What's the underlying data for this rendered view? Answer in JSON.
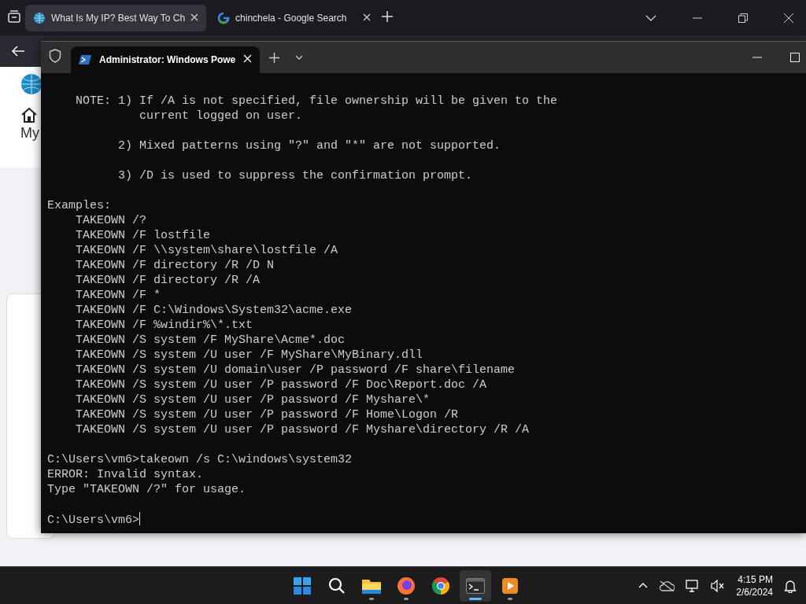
{
  "browser": {
    "tabs": [
      {
        "title": "What Is My IP? Best Way To Ch",
        "selected": true
      },
      {
        "title": "chinchela - Google Search",
        "selected": false
      }
    ],
    "page": {
      "nav_label": "My"
    }
  },
  "terminal": {
    "tab_title": "Administrator: Windows Powe",
    "blocks": [
      {
        "lines": [
          "    NOTE: 1) If /A is not specified, file ownership will be given to the",
          "             current logged on user."
        ]
      },
      {
        "lines": [
          "          2) Mixed patterns using \"?\" and \"*\" are not supported."
        ]
      },
      {
        "lines": [
          "          3) /D is used to suppress the confirmation prompt."
        ]
      },
      {
        "lines": [
          "Examples:",
          "    TAKEOWN /?",
          "    TAKEOWN /F lostfile",
          "    TAKEOWN /F \\\\system\\share\\lostfile /A",
          "    TAKEOWN /F directory /R /D N",
          "    TAKEOWN /F directory /R /A",
          "    TAKEOWN /F *",
          "    TAKEOWN /F C:\\Windows\\System32\\acme.exe",
          "    TAKEOWN /F %windir%\\*.txt",
          "    TAKEOWN /S system /F MyShare\\Acme*.doc",
          "    TAKEOWN /S system /U user /F MyShare\\MyBinary.dll",
          "    TAKEOWN /S system /U domain\\user /P password /F share\\filename",
          "    TAKEOWN /S system /U user /P password /F Doc\\Report.doc /A",
          "    TAKEOWN /S system /U user /P password /F Myshare\\*",
          "    TAKEOWN /S system /U user /P password /F Home\\Logon /R",
          "    TAKEOWN /S system /U user /P password /F Myshare\\directory /R /A"
        ]
      },
      {
        "lines": [
          "C:\\Users\\vm6>takeown /s C:\\windows\\system32",
          "ERROR: Invalid syntax.",
          "Type \"TAKEOWN /?\" for usage."
        ]
      },
      {
        "lines": [
          "C:\\Users\\vm6>"
        ],
        "cursor": true
      }
    ]
  },
  "taskbar": {
    "apps": [
      {
        "kind": "start",
        "open": false,
        "active": false
      },
      {
        "kind": "search",
        "open": false,
        "active": false
      },
      {
        "kind": "folder",
        "open": true,
        "active": false
      },
      {
        "kind": "firefox",
        "open": true,
        "active": false
      },
      {
        "kind": "chrome",
        "open": false,
        "active": false
      },
      {
        "kind": "terminal",
        "open": true,
        "active": true
      },
      {
        "kind": "player",
        "open": true,
        "active": false
      }
    ],
    "time": "4:15 PM",
    "date": "2/6/2024"
  }
}
